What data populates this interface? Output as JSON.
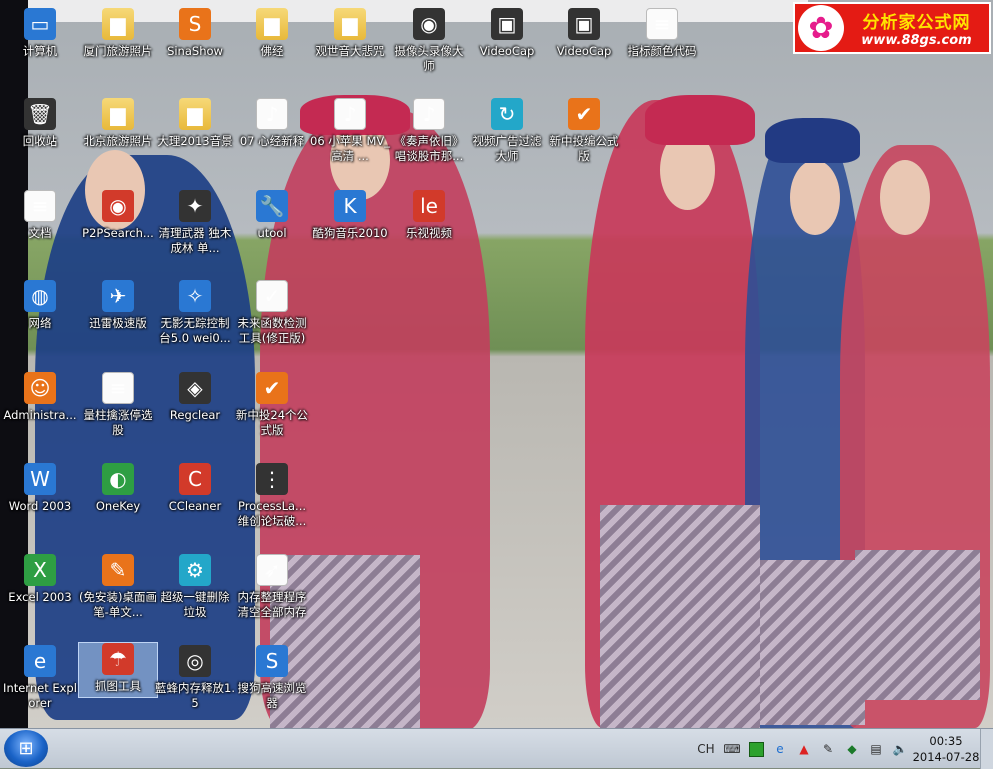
{
  "logo": {
    "title": "分析家公式网",
    "url": "www.88gs.com"
  },
  "icons": [
    {
      "label": "计算机"
    },
    {
      "label": "厦门旅游照片"
    },
    {
      "label": "SinaShow"
    },
    {
      "label": "佛经"
    },
    {
      "label": "观世音大悲咒"
    },
    {
      "label": "摄像头录像大师"
    },
    {
      "label": "VideoCap"
    },
    {
      "label": "VideoCap"
    },
    {
      "label": "指标颜色代码"
    },
    {
      "label": "回收站"
    },
    {
      "label": "北京旅游照片"
    },
    {
      "label": "大理2013音景"
    },
    {
      "label": "07 心经新释"
    },
    {
      "label": "06 小苹果 MV_高清 ..."
    },
    {
      "label": "《奏声依旧》唱谈股市那..."
    },
    {
      "label": "视频广告过滤大师"
    },
    {
      "label": "新中投编公式版"
    },
    {
      "label": "文档"
    },
    {
      "label": "P2PSearch..."
    },
    {
      "label": "清理武器 独木成林 单..."
    },
    {
      "label": "utool"
    },
    {
      "label": "酷狗音乐2010"
    },
    {
      "label": "乐视视频"
    },
    {
      "label": "网络"
    },
    {
      "label": "迅雷极速版"
    },
    {
      "label": "无影无踪控制台5.0 wei0..."
    },
    {
      "label": "未来函数检测工具(修正版)"
    },
    {
      "label": "Administra..."
    },
    {
      "label": "量柱擒涨停选股"
    },
    {
      "label": "Regclear"
    },
    {
      "label": "新中投24个公式版"
    },
    {
      "label": "Word 2003"
    },
    {
      "label": "OneKey"
    },
    {
      "label": "CCleaner"
    },
    {
      "label": "ProcessLa... 维创论坛破..."
    },
    {
      "label": "Excel 2003"
    },
    {
      "label": "(免安装)桌面画笔-单文..."
    },
    {
      "label": "超级一键删除垃圾"
    },
    {
      "label": "内存整理程序 清空全部内存"
    },
    {
      "label": "Internet Explorer"
    },
    {
      "label": "抓图工具"
    },
    {
      "label": "藍蜂内存释放1.5"
    },
    {
      "label": "搜狗高速浏览器"
    }
  ],
  "taskbar": {
    "lang": "CH",
    "time": "00:35",
    "date": "2014-07-28"
  }
}
